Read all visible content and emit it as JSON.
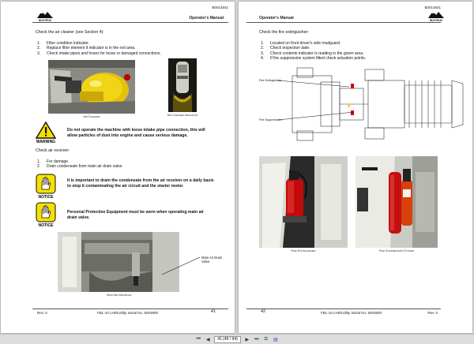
{
  "left_page": {
    "doc_number": "B0014841",
    "header_title": "Operator's Manual",
    "logo_text": "BUCYRUS",
    "intro": "Check the air cleaner (see Section 4):",
    "steps": [
      {
        "n": "1.",
        "text": "Filter condition indicator."
      },
      {
        "n": "2.",
        "text": "Replace filter element if indicator is in the red area."
      },
      {
        "n": "3.",
        "text": "Check intake pipes and hoses for loose or damaged connections."
      }
    ],
    "caption_air_cleaner": "Air Cleaner",
    "caption_indicator": "Air Cleaner Indicator",
    "warning_label": "WARNING",
    "warning_text": "Do not operate the machine with loose intake pipe connection, this will allow particles of dust into engine and cause serious damage.",
    "receiver_intro": "Check air receiver:",
    "receiver_steps": [
      {
        "n": "1.",
        "text": "For damage."
      },
      {
        "n": "2.",
        "text": "Drain condensate from main air drain valve."
      }
    ],
    "notice1_label": "NOTICE",
    "notice1_text": "It is important to drain the condensate from the air receiver on a daily basis to stop it contaminating the air circuit and the starter motor.",
    "notice2_label": "NOTICE",
    "notice2_text": "Personal Protective Equipment must be worn when operating main air drain valve.",
    "callout_valve": "Main Air Drain Valve",
    "caption_manifold": "Main Air Manifold",
    "footer_rev": "Rev. 0",
    "footer_serial": "FBL-10 LHD/Utility Serial No. 5003800",
    "footer_page": "41"
  },
  "right_page": {
    "doc_number": "B0014841",
    "header_title": "Operator's Manual",
    "logo_text": "BUCYRUS",
    "intro": "Check the fire extinguisher:",
    "steps": [
      {
        "n": "1.",
        "text": "Located on front driver's side mudguard."
      },
      {
        "n": "2.",
        "text": "Check inspection date."
      },
      {
        "n": "3.",
        "text": "Check contents indicator is reading in the green area."
      },
      {
        "n": "4.",
        "text": "If fire suppression system fitted check actuation points."
      }
    ],
    "callout_extinguisher": "Fire Extinguisher",
    "callout_suppression": "Fire Suppression",
    "caption_extinguisher": "Fire Extinguisher",
    "caption_suppression": "Fire Suppression System",
    "footer_page": "42",
    "footer_serial": "FBL-10 LHD/Utility Serial No. 5003800",
    "footer_rev": "Rev. 0"
  },
  "toolbar": {
    "page_indicator": "41 (49 / 94)"
  }
}
